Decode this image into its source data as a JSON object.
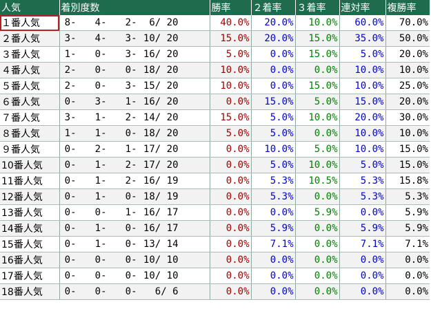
{
  "header": {
    "popularity": "人気",
    "record": "着別度数",
    "win_rate": "勝率",
    "second_rate": "２着率",
    "third_rate": "３着率",
    "quinella_rate": "連対率",
    "place_rate": "複勝率"
  },
  "colors": {
    "header_bg": "#1f6b4e",
    "win": "#a00000",
    "second": "#0000d0",
    "third": "#008000",
    "quinella": "#0000d0",
    "place": "#000000",
    "selected_outline": "#b22222"
  },
  "rows": [
    {
      "label": "１番人気",
      "w": "8-",
      "s": "4-",
      "t": "2-",
      "o": "6/ 20",
      "win": "40.0%",
      "second": "20.0%",
      "third": "10.0%",
      "quinella": "60.0%",
      "place": "70.0%"
    },
    {
      "label": "２番人気",
      "w": "3-",
      "s": "4-",
      "t": "3-",
      "o": "10/ 20",
      "win": "15.0%",
      "second": "20.0%",
      "third": "15.0%",
      "quinella": "35.0%",
      "place": "50.0%"
    },
    {
      "label": "３番人気",
      "w": "1-",
      "s": "0-",
      "t": "3-",
      "o": "16/ 20",
      "win": "5.0%",
      "second": "0.0%",
      "third": "15.0%",
      "quinella": "5.0%",
      "place": "20.0%"
    },
    {
      "label": "４番人気",
      "w": "2-",
      "s": "0-",
      "t": "0-",
      "o": "18/ 20",
      "win": "10.0%",
      "second": "0.0%",
      "third": "0.0%",
      "quinella": "10.0%",
      "place": "10.0%"
    },
    {
      "label": "５番人気",
      "w": "2-",
      "s": "0-",
      "t": "3-",
      "o": "15/ 20",
      "win": "10.0%",
      "second": "0.0%",
      "third": "15.0%",
      "quinella": "10.0%",
      "place": "25.0%"
    },
    {
      "label": "６番人気",
      "w": "0-",
      "s": "3-",
      "t": "1-",
      "o": "16/ 20",
      "win": "0.0%",
      "second": "15.0%",
      "third": "5.0%",
      "quinella": "15.0%",
      "place": "20.0%"
    },
    {
      "label": "７番人気",
      "w": "3-",
      "s": "1-",
      "t": "2-",
      "o": "14/ 20",
      "win": "15.0%",
      "second": "5.0%",
      "third": "10.0%",
      "quinella": "20.0%",
      "place": "30.0%"
    },
    {
      "label": "８番人気",
      "w": "1-",
      "s": "1-",
      "t": "0-",
      "o": "18/ 20",
      "win": "5.0%",
      "second": "5.0%",
      "third": "0.0%",
      "quinella": "10.0%",
      "place": "10.0%"
    },
    {
      "label": "９番人気",
      "w": "0-",
      "s": "2-",
      "t": "1-",
      "o": "17/ 20",
      "win": "0.0%",
      "second": "10.0%",
      "third": "5.0%",
      "quinella": "10.0%",
      "place": "15.0%"
    },
    {
      "label": "10番人気",
      "w": "0-",
      "s": "1-",
      "t": "2-",
      "o": "17/ 20",
      "win": "0.0%",
      "second": "5.0%",
      "third": "10.0%",
      "quinella": "5.0%",
      "place": "15.0%"
    },
    {
      "label": "11番人気",
      "w": "0-",
      "s": "1-",
      "t": "2-",
      "o": "16/ 19",
      "win": "0.0%",
      "second": "5.3%",
      "third": "10.5%",
      "quinella": "5.3%",
      "place": "15.8%"
    },
    {
      "label": "12番人気",
      "w": "0-",
      "s": "1-",
      "t": "0-",
      "o": "18/ 19",
      "win": "0.0%",
      "second": "5.3%",
      "third": "0.0%",
      "quinella": "5.3%",
      "place": "5.3%"
    },
    {
      "label": "13番人気",
      "w": "0-",
      "s": "0-",
      "t": "1-",
      "o": "16/ 17",
      "win": "0.0%",
      "second": "0.0%",
      "third": "5.9%",
      "quinella": "0.0%",
      "place": "5.9%"
    },
    {
      "label": "14番人気",
      "w": "0-",
      "s": "1-",
      "t": "0-",
      "o": "16/ 17",
      "win": "0.0%",
      "second": "5.9%",
      "third": "0.0%",
      "quinella": "5.9%",
      "place": "5.9%"
    },
    {
      "label": "15番人気",
      "w": "0-",
      "s": "1-",
      "t": "0-",
      "o": "13/ 14",
      "win": "0.0%",
      "second": "7.1%",
      "third": "0.0%",
      "quinella": "7.1%",
      "place": "7.1%"
    },
    {
      "label": "16番人気",
      "w": "0-",
      "s": "0-",
      "t": "0-",
      "o": "10/ 10",
      "win": "0.0%",
      "second": "0.0%",
      "third": "0.0%",
      "quinella": "0.0%",
      "place": "0.0%"
    },
    {
      "label": "17番人気",
      "w": "0-",
      "s": "0-",
      "t": "0-",
      "o": "10/ 10",
      "win": "0.0%",
      "second": "0.0%",
      "third": "0.0%",
      "quinella": "0.0%",
      "place": "0.0%"
    },
    {
      "label": "18番人気",
      "w": "0-",
      "s": "0-",
      "t": "0-",
      "o": "6/ 6",
      "win": "0.0%",
      "second": "0.0%",
      "third": "0.0%",
      "quinella": "0.0%",
      "place": "0.0%"
    }
  ]
}
